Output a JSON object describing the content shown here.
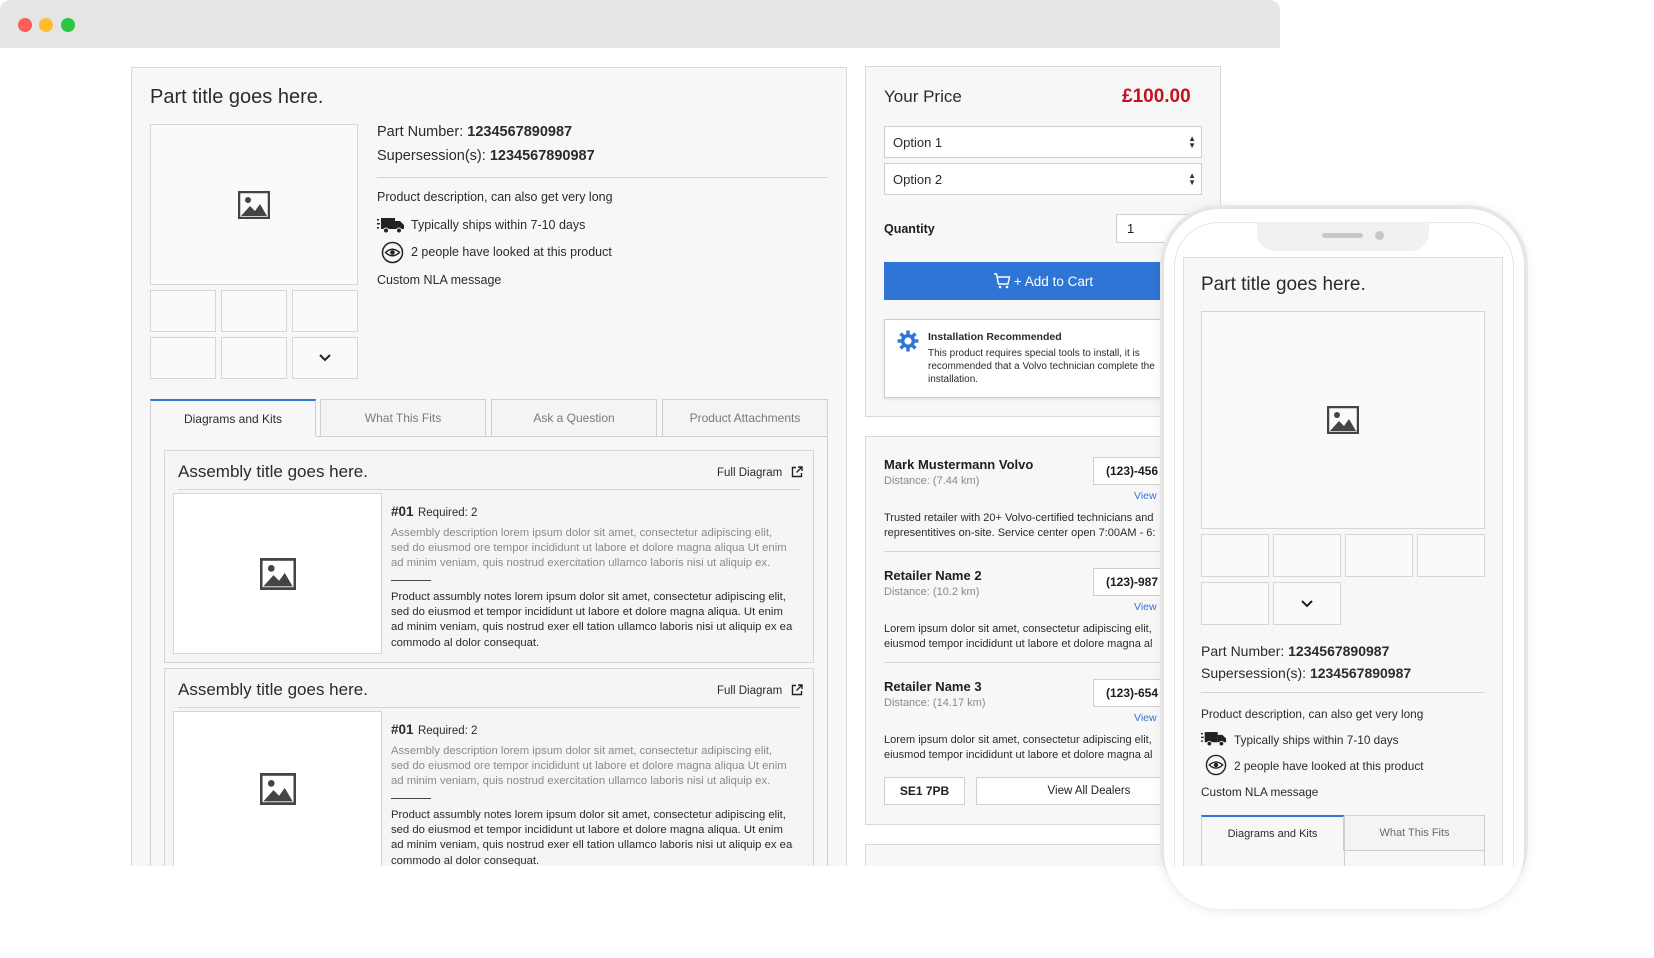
{
  "product": {
    "title": "Part title goes here.",
    "part_number_label": "Part Number:",
    "part_number": "1234567890987",
    "supersession_label": "Supersession(s):",
    "supersession": "1234567890987",
    "description": "Product description, can also get very long",
    "shipping": "Typically ships within 7-10 days",
    "views": "2 people have looked at this product",
    "nla_message": "Custom NLA message"
  },
  "tabs": [
    {
      "label": "Diagrams and Kits"
    },
    {
      "label": "What This Fits"
    },
    {
      "label": "Ask a Question"
    },
    {
      "label": "Product Attachments"
    }
  ],
  "assemblies": [
    {
      "title": "Assembly title goes here.",
      "full_diagram": "Full Diagram",
      "number": "#01",
      "required": "Required: 2",
      "description": [
        "Assembly description lorem ipsum dolor sit amet, consectetur adipiscing elit,",
        "sed do eiusmod ore tempor incididunt ut labore et dolore magna aliqua Ut enim",
        "ad minim veniam, quis nostrud exercitation ullamco laboris nisi ut aliquip ex."
      ],
      "notes": [
        "Product assumbly notes lorem ipsum dolor sit amet, consectetur adipiscing elit,",
        "sed do eiusmod et tempor incididunt ut labore et dolore magna aliqua. Ut enim",
        "ad minim veniam, quis nostrud exer ell tation ullamco laboris nisi ut aliquip ex ea",
        "commodo al dolor consequat."
      ]
    },
    {
      "title": "Assembly title goes here.",
      "full_diagram": "Full Diagram",
      "number": "#01",
      "required": "Required: 2",
      "description": [
        "Assembly description lorem ipsum dolor sit amet, consectetur adipiscing elit,",
        "sed do eiusmod ore tempor incididunt ut labore et dolore magna aliqua Ut enim",
        "ad minim veniam, quis nostrud exercitation ullamco laboris nisi ut aliquip ex."
      ],
      "notes": [
        "Product assumbly notes lorem ipsum dolor sit amet, consectetur adipiscing elit,",
        "sed do eiusmod et tempor incididunt ut labore et dolore magna aliqua. Ut enim",
        "ad minim veniam, quis nostrud exer ell tation ullamco laboris nisi ut aliquip ex ea",
        "commodo al dolor consequat."
      ]
    }
  ],
  "price_panel": {
    "label": "Your Price",
    "price": "£100.00",
    "price_color": "#c0121f",
    "option1": "Option 1",
    "option2": "Option 2",
    "quantity_label": "Quantity",
    "quantity_value": "1",
    "add_to_cart": "+ Add to Cart",
    "cart_button_color": "#2f75d6",
    "install_title": "Installation Recommended",
    "install_text": [
      "This product requires special tools to install, it is",
      "recommended that a Volvo technician complete the",
      "installation."
    ]
  },
  "dealers": [
    {
      "name": "Mark Mustermann Volvo",
      "distance": "Distance: (7.44 km)",
      "phone": "(123)-456",
      "view": "View",
      "desc": [
        "Trusted retailer with 20+ Volvo-certified technicians and",
        "representitives on-site. Service center open 7:00AM - 6:"
      ]
    },
    {
      "name": "Retailer Name 2",
      "distance": "Distance: (10.2 km)",
      "phone": "(123)-987",
      "view": "View",
      "desc": [
        "Lorem ipsum dolor sit amet, consectetur adipiscing elit,",
        "eiusmod tempor incididunt ut labore et dolore magna al"
      ]
    },
    {
      "name": "Retailer Name 3",
      "distance": "Distance: (14.17 km)",
      "phone": "(123)-654",
      "view": "View",
      "desc": [
        "Lorem ipsum dolor sit amet, consectetur adipiscing elit,",
        "eiusmod tempor incididunt ut labore et dolore magna al"
      ]
    }
  ],
  "dealer_footer": {
    "postcode": "SE1 7PB",
    "view_all": "View All Dealers"
  },
  "mobile": {
    "title": "Part title goes here.",
    "part_number_label": "Part Number:",
    "part_number": "1234567890987",
    "supersession_label": "Supersession(s):",
    "supersession": "1234567890987",
    "description": "Product description, can also get very long",
    "shipping": "Typically ships within 7-10 days",
    "views": "2 people have looked at this product",
    "nla_message": "Custom NLA message",
    "tab1": "Diagrams and Kits",
    "tab2": "What This Fits"
  },
  "icons": {
    "image_placeholder": "image-icon",
    "truck": "truck-icon",
    "eye": "eye-icon",
    "chevron": "chevron-down-icon",
    "external": "external-link-icon",
    "cart": "cart-icon",
    "gear": "gear-icon"
  }
}
